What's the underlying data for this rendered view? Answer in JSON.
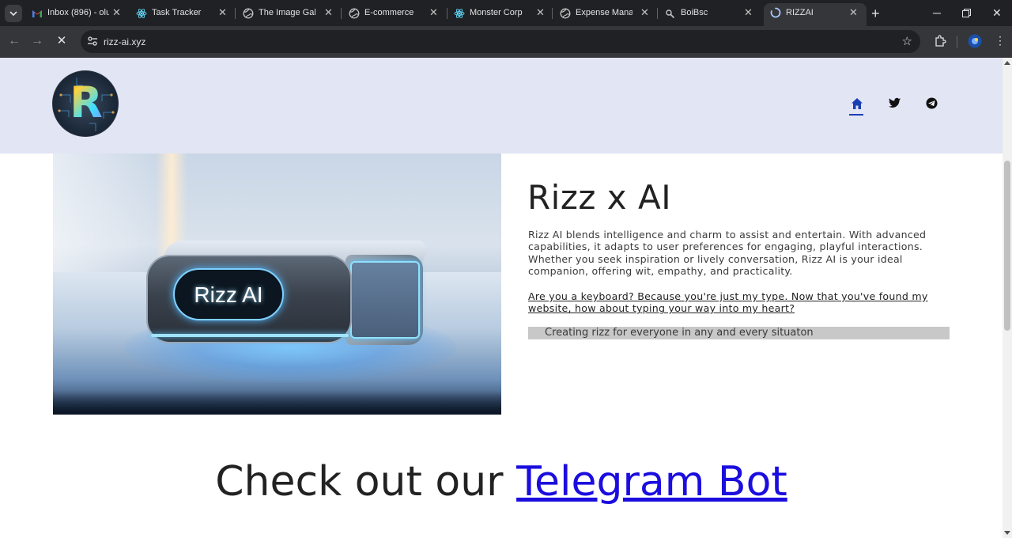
{
  "browser": {
    "tabs": [
      {
        "title": "Inbox (896) - olu",
        "icon": "gmail-icon"
      },
      {
        "title": "Task Tracker",
        "icon": "react-icon"
      },
      {
        "title": "The Image Galle",
        "icon": "globe-icon"
      },
      {
        "title": "E-commerce",
        "icon": "globe-icon"
      },
      {
        "title": "Monster Corp",
        "icon": "react-icon"
      },
      {
        "title": "Expense Manage",
        "icon": "globe-icon"
      },
      {
        "title": "BoiBsc",
        "icon": "link-icon"
      },
      {
        "title": "RIZZAI",
        "icon": "loading-icon",
        "active": true
      }
    ],
    "url": "rizz-ai.xyz"
  },
  "header": {
    "logo_letter": "R",
    "nav": [
      {
        "name": "home",
        "icon": "home-icon",
        "active": true
      },
      {
        "name": "twitter",
        "icon": "twitter-icon"
      },
      {
        "name": "telegram",
        "icon": "telegram-icon"
      }
    ]
  },
  "hero": {
    "image_label": "Rizz AI",
    "title": "Rizz x AI",
    "description": "Rizz AI blends intelligence and charm to assist and entertain. With advanced capabilities, it adapts to user preferences for engaging, playful interactions. Whether you seek inspiration or lively conversation, Rizz AI is your ideal companion, offering wit, empathy, and practicality.",
    "joke": "Are you a keyboard? Because you're just my type. Now that you've found my website, how about typing your way into my heart?",
    "tagline": "Creating rizz for everyone in any and every situaton"
  },
  "cta": {
    "prefix": "Check out our ",
    "link_text": "Telegram Bot"
  },
  "colors": {
    "header_bg": "#e2e5f3",
    "link": "#1a0dde",
    "nav_active": "#1a3fb5",
    "tagline_bg": "#c8c8c8"
  }
}
